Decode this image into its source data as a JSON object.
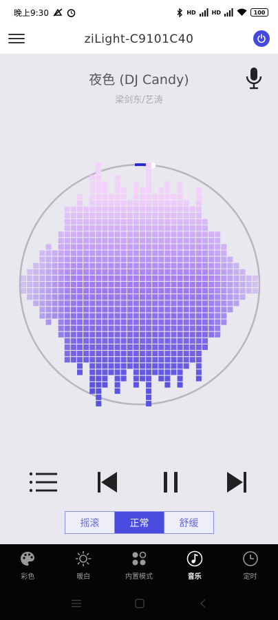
{
  "status_bar": {
    "time": "晚上9:30",
    "signal1": "HD",
    "signal2": "HD",
    "battery": "100"
  },
  "app_bar": {
    "title": "ziLight-C9101C40"
  },
  "now_playing": {
    "title": "夜色 (DJ Candy)",
    "artist": "梁剑东/艺涛"
  },
  "progress": 0.02,
  "colors": {
    "accent": "#4a4ce0",
    "bars_top": "#f2d2fa",
    "bars_mid": "#9a74f0",
    "bars_bottom": "#5a52e0",
    "nav_bg": "#050505"
  },
  "modes": [
    {
      "label": "摇滚",
      "active": false
    },
    {
      "label": "正常",
      "active": true
    },
    {
      "label": "舒缓",
      "active": false
    }
  ],
  "nav": [
    {
      "label": "彩色",
      "icon": "palette-icon",
      "active": false
    },
    {
      "label": "暖白",
      "icon": "sun-icon",
      "active": false
    },
    {
      "label": "内置模式",
      "icon": "dots-grid-icon",
      "active": false
    },
    {
      "label": "音乐",
      "icon": "music-note-icon",
      "active": true
    },
    {
      "label": "定时",
      "icon": "clock-icon",
      "active": false
    }
  ],
  "equalizer_levels": [
    1,
    2,
    3,
    5,
    6,
    5,
    8,
    12,
    12,
    14,
    12,
    17,
    19,
    16,
    14,
    17,
    15,
    13,
    16,
    15,
    19,
    14,
    15,
    16,
    14,
    16,
    13,
    12,
    15,
    10,
    8,
    8,
    6,
    4,
    3,
    2,
    1,
    1
  ]
}
